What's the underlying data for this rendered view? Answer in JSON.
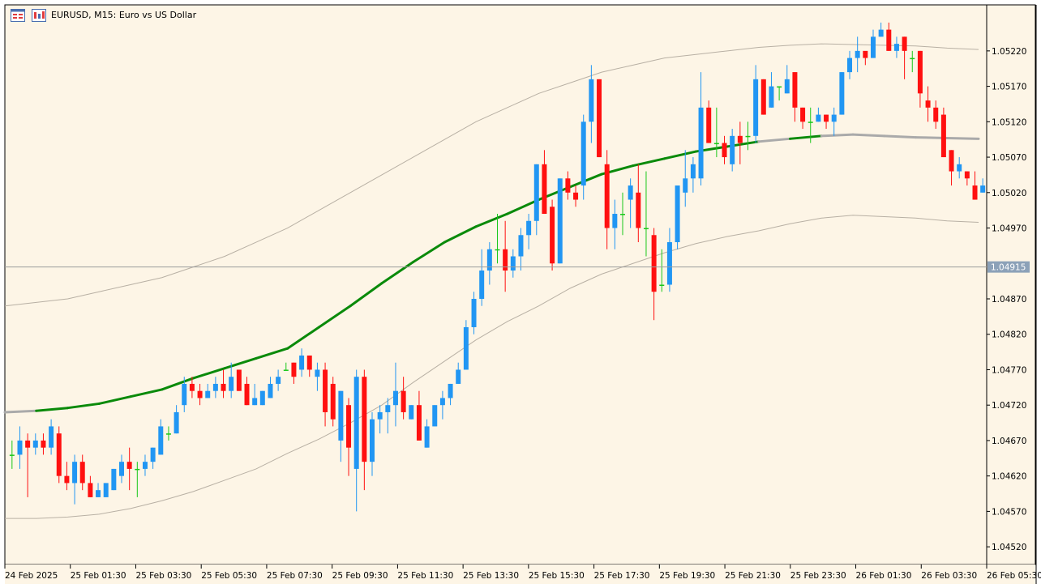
{
  "chart_data": {
    "type": "candlestick",
    "title": "EURUSD, M15:  Euro vs US Dollar",
    "symbol": "EURUSD",
    "timeframe": "M15",
    "ylim": [
      1.04495,
      1.05285
    ],
    "y_ticks": [
      1.0522,
      1.0517,
      1.0512,
      1.0507,
      1.0502,
      1.0497,
      1.0487,
      1.0482,
      1.0477,
      1.0472,
      1.0467,
      1.0462,
      1.0457,
      1.0452
    ],
    "y_tick_labels": [
      "1.05220",
      "1.05170",
      "1.05120",
      "1.05070",
      "1.05020",
      "1.04970",
      "1.04870",
      "1.04820",
      "1.04770",
      "1.04720",
      "1.04670",
      "1.04620",
      "1.04570",
      "1.04520"
    ],
    "x_labels": [
      "24 Feb 2025",
      "25 Feb 01:30",
      "25 Feb 03:30",
      "25 Feb 05:30",
      "25 Feb 07:30",
      "25 Feb 09:30",
      "25 Feb 11:30",
      "25 Feb 13:30",
      "25 Feb 15:30",
      "25 Feb 17:30",
      "25 Feb 19:30",
      "25 Feb 21:30",
      "25 Feb 23:30",
      "26 Feb 01:30",
      "26 Feb 03:30",
      "26 Feb 05:30"
    ],
    "current_price": "1.04915",
    "current_price_value": 1.04915,
    "candles": [
      [
        1.0465,
        1.0467,
        1.0463,
        1.0465
      ],
      [
        1.0465,
        1.0469,
        1.0463,
        1.0467
      ],
      [
        1.0467,
        1.0468,
        1.0459,
        1.0466
      ],
      [
        1.0466,
        1.0468,
        1.0465,
        1.0467
      ],
      [
        1.0467,
        1.0468,
        1.0465,
        1.0466
      ],
      [
        1.0466,
        1.047,
        1.0465,
        1.0469
      ],
      [
        1.0468,
        1.0469,
        1.0461,
        1.0462
      ],
      [
        1.0462,
        1.0464,
        1.046,
        1.0461
      ],
      [
        1.0461,
        1.0465,
        1.0458,
        1.0464
      ],
      [
        1.0464,
        1.0465,
        1.046,
        1.0461
      ],
      [
        1.0461,
        1.0462,
        1.0459,
        1.0459
      ],
      [
        1.0459,
        1.0461,
        1.0459,
        1.046
      ],
      [
        1.0459,
        1.0461,
        1.0459,
        1.0461
      ],
      [
        1.046,
        1.0463,
        1.046,
        1.0463
      ],
      [
        1.0462,
        1.0465,
        1.0461,
        1.0464
      ],
      [
        1.0464,
        1.0466,
        1.046,
        1.0463
      ],
      [
        1.0463,
        1.0464,
        1.0459,
        1.0463
      ],
      [
        1.0463,
        1.0465,
        1.0462,
        1.0464
      ],
      [
        1.0464,
        1.0466,
        1.0463,
        1.0466
      ],
      [
        1.0465,
        1.047,
        1.0465,
        1.0469
      ],
      [
        1.0468,
        1.0469,
        1.0467,
        1.0468
      ],
      [
        1.0468,
        1.0472,
        1.0468,
        1.0471
      ],
      [
        1.0472,
        1.0476,
        1.0471,
        1.0475
      ],
      [
        1.0475,
        1.0476,
        1.0473,
        1.0474
      ],
      [
        1.0474,
        1.0475,
        1.0472,
        1.0473
      ],
      [
        1.0473,
        1.0475,
        1.0473,
        1.0474
      ],
      [
        1.0474,
        1.0476,
        1.0473,
        1.0475
      ],
      [
        1.0475,
        1.0477,
        1.0473,
        1.0474
      ],
      [
        1.0474,
        1.0478,
        1.0473,
        1.0476
      ],
      [
        1.0477,
        1.0477,
        1.0474,
        1.0474
      ],
      [
        1.0475,
        1.0476,
        1.0472,
        1.0472
      ],
      [
        1.0472,
        1.0475,
        1.0472,
        1.0473
      ],
      [
        1.0472,
        1.0474,
        1.0472,
        1.0474
      ],
      [
        1.0473,
        1.0476,
        1.0473,
        1.0475
      ],
      [
        1.0475,
        1.0477,
        1.0474,
        1.0476
      ],
      [
        1.0477,
        1.0478,
        1.0477,
        1.0477
      ],
      [
        1.0478,
        1.0478,
        1.0475,
        1.0476
      ],
      [
        1.0477,
        1.048,
        1.0476,
        1.0479
      ],
      [
        1.0479,
        1.0479,
        1.0476,
        1.0477
      ],
      [
        1.0476,
        1.0478,
        1.0474,
        1.0477
      ],
      [
        1.0477,
        1.0478,
        1.0469,
        1.0471
      ],
      [
        1.0475,
        1.0476,
        1.0469,
        1.047
      ],
      [
        1.0467,
        1.0474,
        1.0464,
        1.0474
      ],
      [
        1.0472,
        1.0473,
        1.0462,
        1.0466
      ],
      [
        1.0463,
        1.0477,
        1.0457,
        1.0476
      ],
      [
        1.0476,
        1.0477,
        1.046,
        1.0464
      ],
      [
        1.0464,
        1.0471,
        1.0462,
        1.047
      ],
      [
        1.047,
        1.0472,
        1.0468,
        1.0471
      ],
      [
        1.0471,
        1.0473,
        1.0468,
        1.0472
      ],
      [
        1.0472,
        1.0478,
        1.0469,
        1.0474
      ],
      [
        1.0474,
        1.0476,
        1.047,
        1.0471
      ],
      [
        1.047,
        1.0472,
        1.047,
        1.0472
      ],
      [
        1.0472,
        1.0474,
        1.0467,
        1.0467
      ],
      [
        1.0466,
        1.047,
        1.0466,
        1.0469
      ],
      [
        1.0469,
        1.0472,
        1.0469,
        1.0472
      ],
      [
        1.0472,
        1.0474,
        1.047,
        1.0473
      ],
      [
        1.0473,
        1.0475,
        1.0472,
        1.0475
      ],
      [
        1.0475,
        1.0478,
        1.0475,
        1.0477
      ],
      [
        1.0477,
        1.0484,
        1.0477,
        1.0483
      ],
      [
        1.0483,
        1.0488,
        1.0482,
        1.0487
      ],
      [
        1.0487,
        1.0494,
        1.0486,
        1.0491
      ],
      [
        1.0491,
        1.0495,
        1.0489,
        1.0494
      ],
      [
        1.0494,
        1.0499,
        1.0492,
        1.0494
      ],
      [
        1.0494,
        1.0498,
        1.0488,
        1.0491
      ],
      [
        1.0491,
        1.0494,
        1.049,
        1.0493
      ],
      [
        1.0493,
        1.0497,
        1.0491,
        1.0496
      ],
      [
        1.0496,
        1.0499,
        1.0494,
        1.0498
      ],
      [
        1.0498,
        1.0506,
        1.0496,
        1.0506
      ],
      [
        1.0506,
        1.0508,
        1.0499,
        1.0499
      ],
      [
        1.05,
        1.0501,
        1.0491,
        1.0492
      ],
      [
        1.0492,
        1.0504,
        1.0492,
        1.0504
      ],
      [
        1.0504,
        1.0505,
        1.0501,
        1.0502
      ],
      [
        1.0502,
        1.0503,
        1.05,
        1.0501
      ],
      [
        1.0503,
        1.0513,
        1.0501,
        1.0512
      ],
      [
        1.0512,
        1.052,
        1.0509,
        1.0518
      ],
      [
        1.0518,
        1.0518,
        1.0507,
        1.0507
      ],
      [
        1.0506,
        1.0508,
        1.0494,
        1.0497
      ],
      [
        1.0497,
        1.0501,
        1.0494,
        1.0499
      ],
      [
        1.0499,
        1.0502,
        1.0496,
        1.0499
      ],
      [
        1.0501,
        1.0504,
        1.0497,
        1.0503
      ],
      [
        1.0502,
        1.0506,
        1.0495,
        1.0497
      ],
      [
        1.0497,
        1.0505,
        1.0493,
        1.0497
      ],
      [
        1.0496,
        1.0497,
        1.0484,
        1.0488
      ],
      [
        1.0489,
        1.0494,
        1.0488,
        1.0489
      ],
      [
        1.0489,
        1.0497,
        1.0488,
        1.0495
      ],
      [
        1.0495,
        1.0502,
        1.0494,
        1.0503
      ],
      [
        1.0502,
        1.0508,
        1.05,
        1.0504
      ],
      [
        1.0504,
        1.0507,
        1.0502,
        1.0506
      ],
      [
        1.0504,
        1.0519,
        1.0503,
        1.0514
      ],
      [
        1.0514,
        1.0515,
        1.0509,
        1.0509
      ],
      [
        1.0509,
        1.0514,
        1.0507,
        1.0509
      ],
      [
        1.0509,
        1.051,
        1.0506,
        1.0507
      ],
      [
        1.0506,
        1.0511,
        1.0505,
        1.051
      ],
      [
        1.051,
        1.0512,
        1.0506,
        1.0509
      ],
      [
        1.051,
        1.0512,
        1.0508,
        1.051
      ],
      [
        1.051,
        1.052,
        1.0509,
        1.0518
      ],
      [
        1.0518,
        1.0518,
        1.0513,
        1.0513
      ],
      [
        1.0514,
        1.0519,
        1.0514,
        1.0517
      ],
      [
        1.0517,
        1.0517,
        1.0515,
        1.0517
      ],
      [
        1.0516,
        1.052,
        1.0516,
        1.0518
      ],
      [
        1.0519,
        1.0519,
        1.0512,
        1.0514
      ],
      [
        1.0514,
        1.0514,
        1.0511,
        1.0512
      ],
      [
        1.0512,
        1.0514,
        1.0509,
        1.0512
      ],
      [
        1.0512,
        1.0514,
        1.0512,
        1.0513
      ],
      [
        1.0513,
        1.0513,
        1.0511,
        1.0512
      ],
      [
        1.0512,
        1.0514,
        1.051,
        1.0513
      ],
      [
        1.0513,
        1.0519,
        1.0513,
        1.0519
      ],
      [
        1.0519,
        1.0522,
        1.0518,
        1.0521
      ],
      [
        1.0521,
        1.0524,
        1.0519,
        1.0522
      ],
      [
        1.0522,
        1.0521,
        1.052,
        1.0521
      ],
      [
        1.0521,
        1.0525,
        1.0521,
        1.0524
      ],
      [
        1.0524,
        1.0526,
        1.0524,
        1.0525
      ],
      [
        1.0525,
        1.0526,
        1.0522,
        1.0522
      ],
      [
        1.0522,
        1.0524,
        1.0521,
        1.0523
      ],
      [
        1.0524,
        1.0524,
        1.0518,
        1.0522
      ],
      [
        1.0521,
        1.0522,
        1.0519,
        1.0521
      ],
      [
        1.0522,
        1.0522,
        1.0514,
        1.0516
      ],
      [
        1.0515,
        1.0517,
        1.0512,
        1.0514
      ],
      [
        1.0514,
        1.0515,
        1.0511,
        1.0512
      ],
      [
        1.0513,
        1.0514,
        1.0507,
        1.0507
      ],
      [
        1.0508,
        1.0508,
        1.0503,
        1.0505
      ],
      [
        1.0505,
        1.0507,
        1.0504,
        1.0506
      ],
      [
        1.0505,
        1.0505,
        1.0503,
        1.0504
      ],
      [
        1.0503,
        1.0505,
        1.0501,
        1.0501
      ],
      [
        1.0502,
        1.0504,
        1.0502,
        1.0503
      ]
    ],
    "series": [
      {
        "type": "band",
        "values": [
          1.0486,
          1.04865,
          1.0487,
          1.0488,
          1.0489,
          1.049,
          1.04915,
          1.0493,
          1.0495,
          1.0497,
          1.04995,
          1.0502,
          1.05045,
          1.0507,
          1.05095,
          1.0512,
          1.0514,
          1.0516,
          1.05175,
          1.0519,
          1.052,
          1.0521,
          1.05215,
          1.0522,
          1.05225,
          1.05228,
          1.0523,
          1.05229,
          1.05228,
          1.05227,
          1.05224,
          1.05222
        ]
      },
      {
        "type": "moving-average",
        "values": [
          1.0471,
          1.04712,
          1.04716,
          1.04722,
          1.04732,
          1.04742,
          1.04758,
          1.04772,
          1.04786,
          1.048,
          1.0483,
          1.0486,
          1.04892,
          1.04922,
          1.0495,
          1.04972,
          1.0499,
          1.0501,
          1.05028,
          1.05046,
          1.05058,
          1.05068,
          1.05078,
          1.05085,
          1.05092,
          1.05096,
          1.051,
          1.05102,
          1.051,
          1.05098,
          1.05097,
          1.05096
        ]
      },
      {
        "type": "band",
        "values": [
          1.0456,
          1.0456,
          1.04562,
          1.04566,
          1.04574,
          1.04585,
          1.04598,
          1.04614,
          1.0463,
          1.04652,
          1.04672,
          1.04695,
          1.0472,
          1.04752,
          1.04782,
          1.04812,
          1.04838,
          1.0486,
          1.04885,
          1.04905,
          1.0492,
          1.04935,
          1.04948,
          1.04958,
          1.04966,
          1.04976,
          1.04984,
          1.04988,
          1.04986,
          1.04984,
          1.0498,
          1.04978
        ]
      }
    ],
    "colors": {
      "background": "#fdf5e6",
      "bull": "#2196f3",
      "bear": "#ff1010",
      "doji": "#19c719",
      "ma_up": "#0a8a0a",
      "ma_flat": "#aaaaaa",
      "band": "#b8b0a4",
      "price_line": "#9c9c9c",
      "price_label": "#8ca1b8"
    }
  }
}
